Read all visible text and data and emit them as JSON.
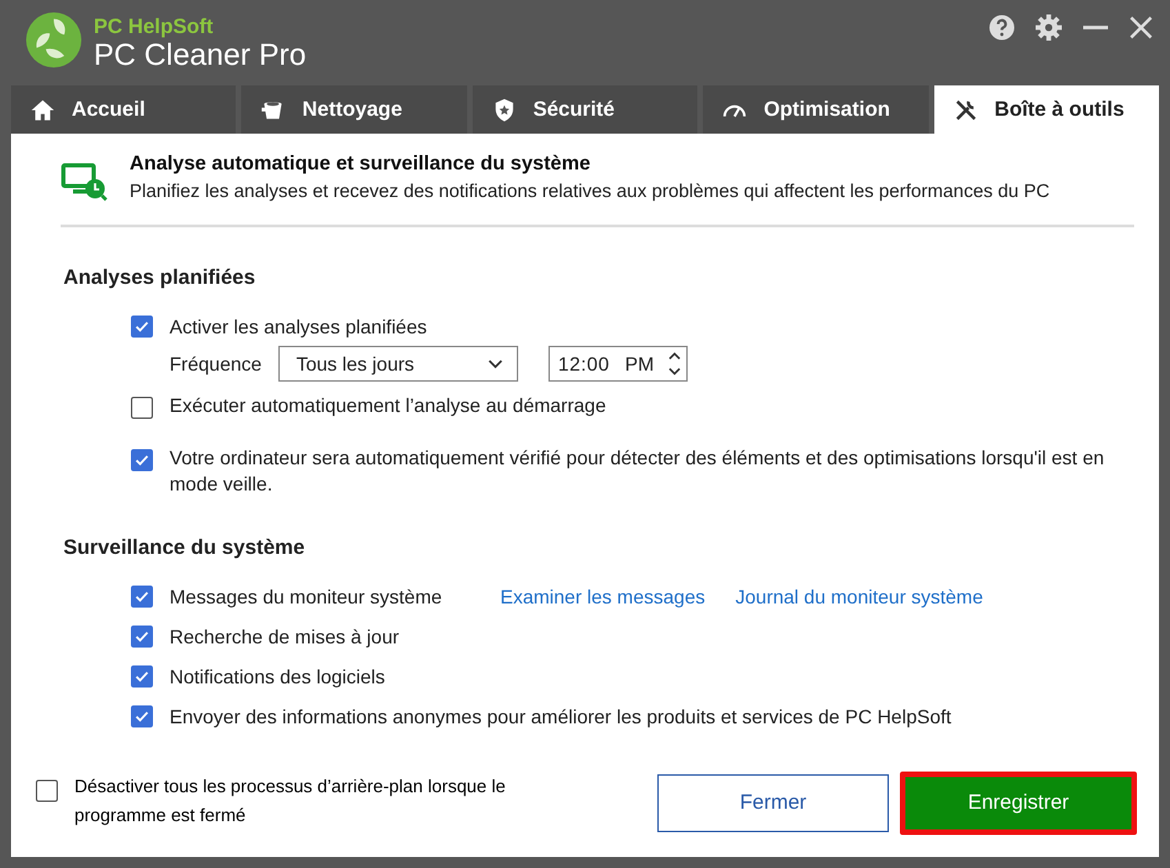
{
  "app": {
    "vendor": "PC HelpSoft",
    "title": "PC Cleaner Pro"
  },
  "tabs": [
    {
      "label": "Accueil",
      "selected": false
    },
    {
      "label": "Nettoyage",
      "selected": false
    },
    {
      "label": "Sécurité",
      "selected": false
    },
    {
      "label": "Optimisation",
      "selected": false
    },
    {
      "label": "Boîte à outils",
      "selected": true
    }
  ],
  "header": {
    "title": "Analyse automatique et surveillance du système",
    "subtitle": "Planifiez les analyses et recevez des notifications relatives aux problèmes qui affectent les performances du PC"
  },
  "scheduled": {
    "title": "Analyses planifiées",
    "enable": {
      "label": "Activer les analyses planifiées",
      "checked": true
    },
    "frequency": {
      "label": "Fréquence",
      "value": "Tous les jours"
    },
    "time": {
      "value": "12:00",
      "period": "PM"
    },
    "options": [
      {
        "label": "Exécuter automatiquement l’analyse au démarrage",
        "checked": false
      },
      {
        "label": "Votre ordinateur sera automatiquement vérifié pour détecter des éléments et des optimisations lorsqu'il est en mode veille.",
        "checked": true
      }
    ]
  },
  "monitoring": {
    "title": "Surveillance du système",
    "options": [
      {
        "label": "Messages du moniteur système",
        "checked": true,
        "links": [
          "Examiner les messages",
          "Journal du moniteur système"
        ]
      },
      {
        "label": "Recherche de mises à jour",
        "checked": true
      },
      {
        "label": "Notifications des logiciels",
        "checked": true
      },
      {
        "label": "Envoyer des informations anonymes pour améliorer les produits et services de PC HelpSoft",
        "checked": true
      }
    ]
  },
  "footer": {
    "background": {
      "label": "Désactiver tous les processus d’arrière-plan lorsque le programme est fermé",
      "checked": false
    },
    "buttons": [
      {
        "label": "Fermer",
        "kind": "secondary"
      },
      {
        "label": "Enregistrer",
        "kind": "primary"
      }
    ]
  }
}
